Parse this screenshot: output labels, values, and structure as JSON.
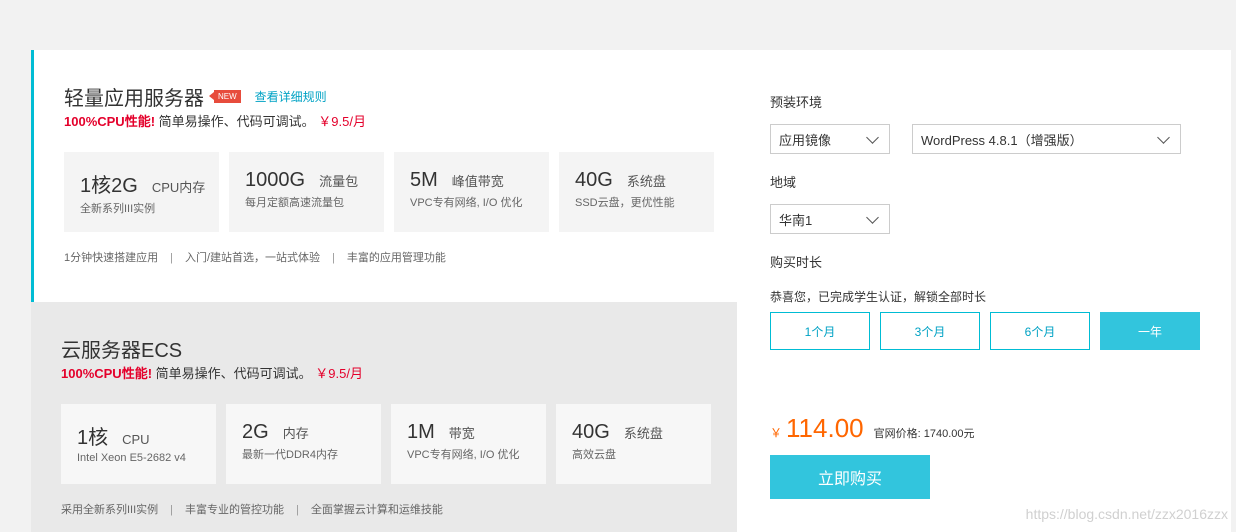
{
  "lightServer": {
    "title": "轻量应用服务器",
    "badge": "NEW",
    "rulesLink": "查看详细规则",
    "subtitle": {
      "highlight": "100%CPU性能!",
      "text": "简单易操作、代码可调试。",
      "price": "￥9.5/月"
    },
    "specs": [
      {
        "value": "1核2G",
        "unit": "CPU内存",
        "desc": "全新系列III实例"
      },
      {
        "value": "1000G",
        "unit": "流量包",
        "desc": "每月定额高速流量包"
      },
      {
        "value": "5M",
        "unit": "峰值带宽",
        "desc": "VPC专有网络, I/O 优化"
      },
      {
        "value": "40G",
        "unit": "系统盘",
        "desc": "SSD云盘，更优性能"
      }
    ],
    "features": [
      "1分钟快速搭建应用",
      "入门/建站首选，一站式体验",
      "丰富的应用管理功能"
    ]
  },
  "ecs": {
    "title": "云服务器ECS",
    "subtitle": {
      "highlight": "100%CPU性能!",
      "text": "简单易操作、代码可调试。",
      "price": "￥9.5/月"
    },
    "specs": [
      {
        "value": "1核",
        "unit": "CPU",
        "desc": "Intel Xeon E5-2682 v4"
      },
      {
        "value": "2G",
        "unit": "内存",
        "desc": "最新一代DDR4内存"
      },
      {
        "value": "1M",
        "unit": "带宽",
        "desc": "VPC专有网络, I/O 优化"
      },
      {
        "value": "40G",
        "unit": "系统盘",
        "desc": "高效云盘"
      }
    ],
    "features": [
      "采用全新系列III实例",
      "丰富专业的管控功能",
      "全面掌握云计算和运维技能"
    ]
  },
  "config": {
    "envLabel": "预装环境",
    "imageSelect": "应用镜像",
    "appSelect": "WordPress 4.8.1（增强版）",
    "regionLabel": "地域",
    "regionSelect": "华南1",
    "durationLabel": "购买时长",
    "notice": "恭喜您，已完成学生认证，解锁全部时长",
    "durations": [
      "1个月",
      "3个月",
      "6个月",
      "一年"
    ],
    "currency": "￥",
    "price": "114.00",
    "officialPrice": "官网价格: 1740.00元",
    "buyButton": "立即购买"
  },
  "watermark": "https://blog.csdn.net/zzx2016zzx",
  "colors": {
    "accent": "#32c5dd",
    "price": "#ff6600",
    "highlight": "#e4002b",
    "badge": "#e74c3c"
  }
}
